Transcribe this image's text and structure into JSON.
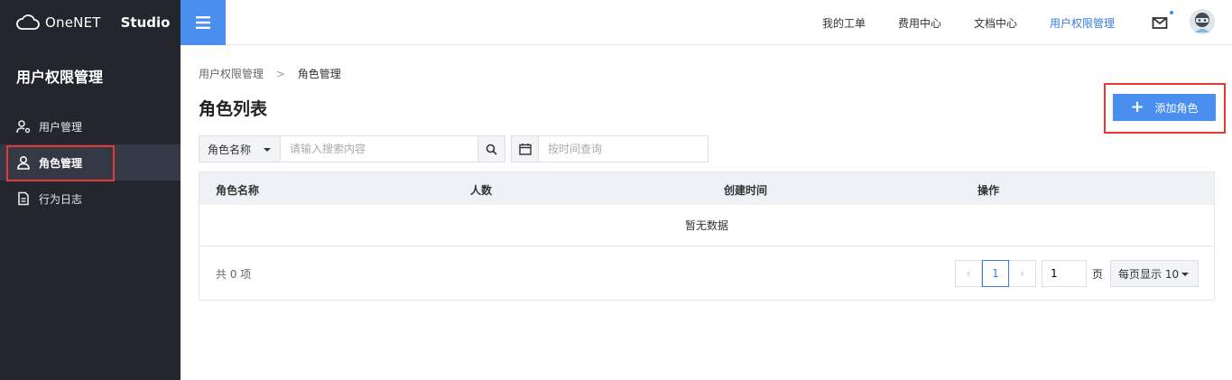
{
  "brand": {
    "logo_text": "OneNET",
    "studio": "Studio"
  },
  "nav": {
    "links": [
      {
        "label": "我的工单"
      },
      {
        "label": "费用中心"
      },
      {
        "label": "文档中心"
      },
      {
        "label": "用户权限管理",
        "active": true
      }
    ]
  },
  "sidebar": {
    "title": "用户权限管理",
    "items": [
      {
        "label": "用户管理"
      },
      {
        "label": "角色管理",
        "active": true
      },
      {
        "label": "行为日志"
      }
    ]
  },
  "breadcrumb": {
    "parent": "用户权限管理",
    "separator": ">",
    "current": "角色管理"
  },
  "page": {
    "title": "角色列表",
    "add_button": "添加角色"
  },
  "filter": {
    "select_value": "角色名称",
    "search_placeholder": "请输入搜索内容",
    "date_placeholder": "按时间查询"
  },
  "table": {
    "columns": [
      "角色名称",
      "人数",
      "创建时间",
      "操作"
    ],
    "empty_text": "暂无数据",
    "total_text": "共 0 项"
  },
  "pagination": {
    "prev": "‹",
    "current_page": "1",
    "next": "›",
    "page_input_value": "1",
    "page_unit": "页",
    "per_page": "每页显示 10"
  },
  "colors": {
    "accent": "#4a8ff0",
    "sidebar_bg": "#24262e",
    "highlight": "#e53935"
  }
}
